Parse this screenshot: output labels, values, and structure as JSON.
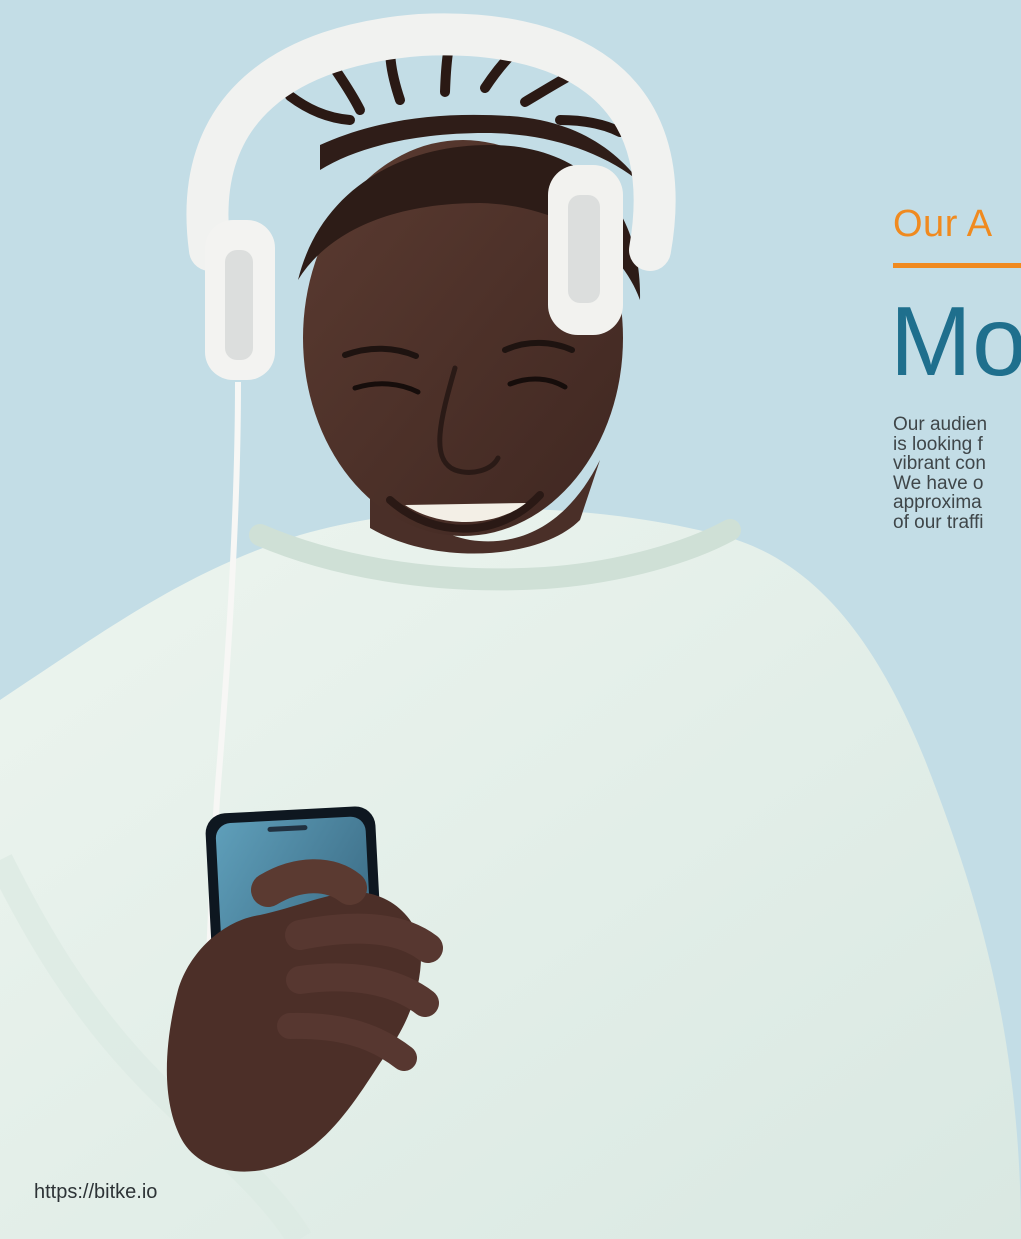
{
  "page": {
    "kicker": "Our A",
    "headline": "Mo",
    "body_lines": [
      "Our audien",
      "is looking f",
      "vibrant con",
      "We have o",
      "approxima",
      "of our traffi"
    ],
    "url": "https://bitke.io"
  },
  "colors": {
    "background": "#c3dde6",
    "accent_orange": "#f08a1f",
    "headline_blue": "#1f6f8d",
    "body_text": "#3f4649"
  },
  "image": {
    "description_icon": "person-with-headphones-and-phone-photo"
  }
}
